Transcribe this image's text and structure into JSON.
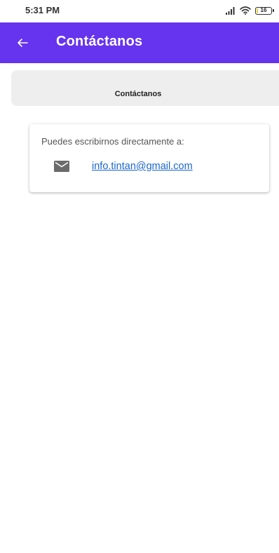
{
  "status_bar": {
    "time": "5:31 PM",
    "battery_level": "16",
    "icons": [
      "signal-icon",
      "wifi-icon",
      "battery-icon"
    ]
  },
  "app_bar": {
    "back_icon": "arrow-back-icon",
    "title": "Contáctanos",
    "background_color": "#6633ee"
  },
  "section": {
    "title": "Contáctanos"
  },
  "contact_card": {
    "intro": "Puedes escribirnos directamente a:",
    "mail_icon": "mail-icon",
    "email": "info.tintan@gmail.com",
    "link_color": "#1a66c9"
  }
}
